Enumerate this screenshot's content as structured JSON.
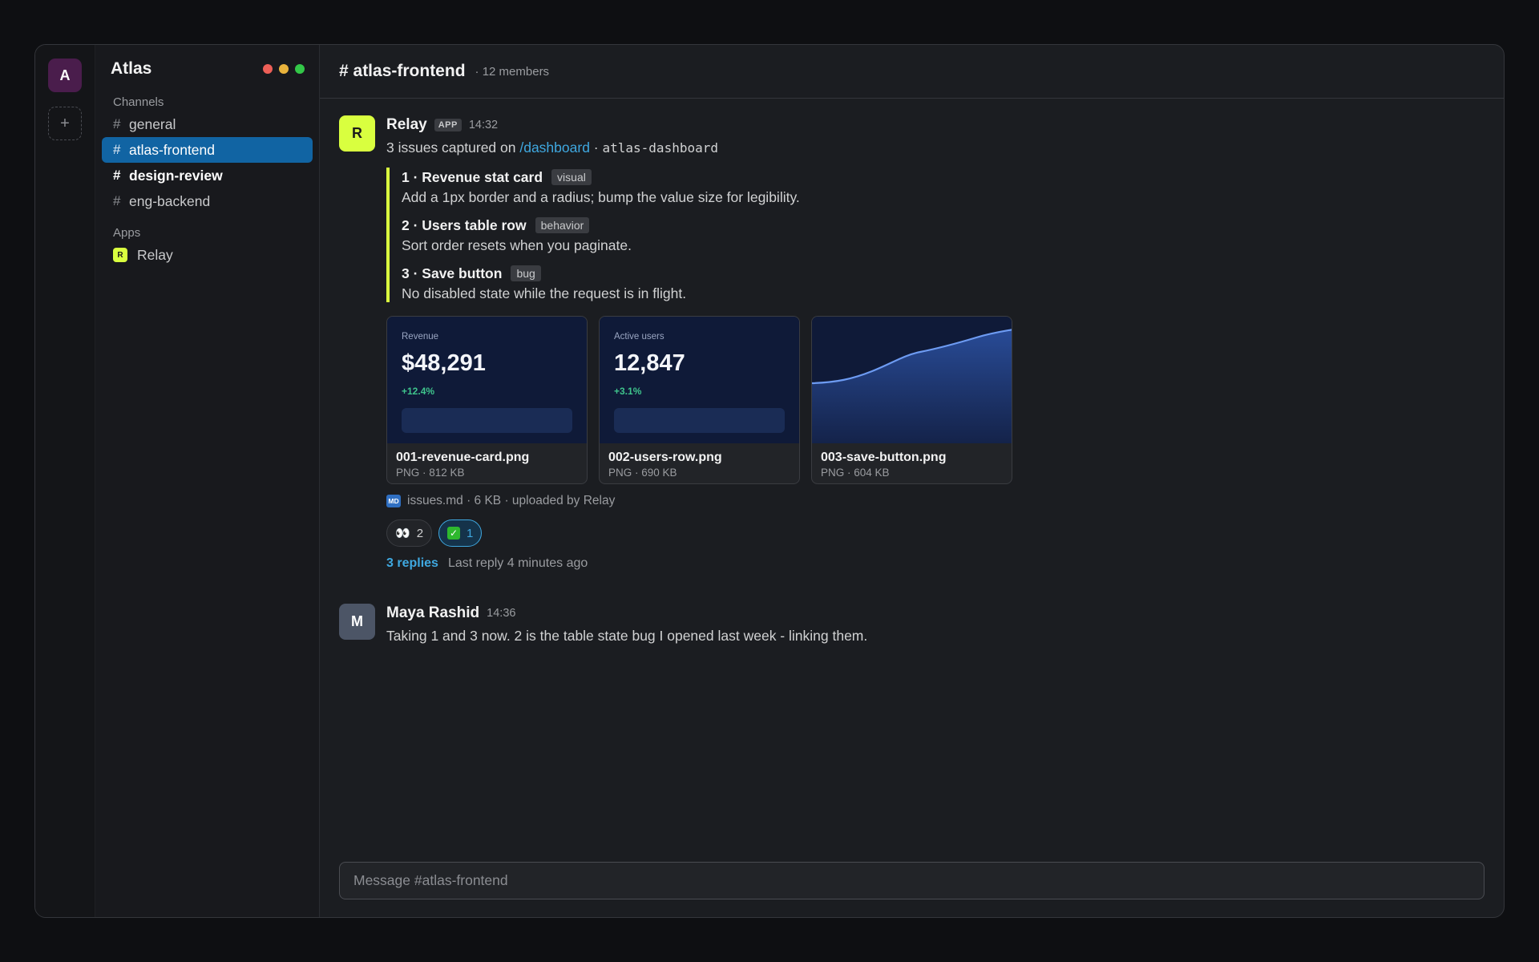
{
  "workspace": {
    "initial": "A",
    "add_symbol": "+",
    "name": "Atlas"
  },
  "sidebar": {
    "channels_label": "Channels",
    "channels": [
      {
        "name": "general",
        "state": "normal"
      },
      {
        "name": "atlas-frontend",
        "state": "active"
      },
      {
        "name": "design-review",
        "state": "unread"
      },
      {
        "name": "eng-backend",
        "state": "normal"
      }
    ],
    "apps_label": "Apps",
    "apps": [
      {
        "name": "Relay",
        "badge": "R"
      }
    ],
    "hash": "#"
  },
  "header": {
    "channel": "# atlas-frontend",
    "members": "· 12 members"
  },
  "messages": [
    {
      "avatar": "R",
      "author": "Relay",
      "badge": "APP",
      "time": "14:32",
      "text_prefix": "3 issues captured on ",
      "link": "/dashboard",
      "text_sep": " · ",
      "code": "atlas-dashboard",
      "issues": [
        {
          "title": "1 · Revenue stat card",
          "tag": "visual",
          "desc": "Add a 1px border and a radius; bump the value size for legibility."
        },
        {
          "title": "2 · Users table row",
          "tag": "behavior",
          "desc": "Sort order resets when you paginate."
        },
        {
          "title": "3 · Save button",
          "tag": "bug",
          "desc": "No disabled state while the request is in flight."
        }
      ],
      "attachments": [
        {
          "name": "001-revenue-card.png",
          "size": "PNG · 812 KB",
          "thumb_label": "Revenue",
          "thumb_value": "$48,291",
          "thumb_delta": "+12.4%"
        },
        {
          "name": "002-users-row.png",
          "size": "PNG · 690 KB",
          "thumb_label": "Active users",
          "thumb_value": "12,847",
          "thumb_delta": "+3.1%"
        },
        {
          "name": "003-save-button.png",
          "size": "PNG · 604 KB"
        }
      ],
      "file": {
        "icon": "MD",
        "text": "issues.md · 6 KB · uploaded by Relay"
      },
      "reactions": [
        {
          "emoji": "👀",
          "count": "2",
          "mine": false
        },
        {
          "emoji": "✓",
          "count": "1",
          "mine": true
        }
      ],
      "replies": {
        "count": "3 replies",
        "last": "Last reply 4 minutes ago"
      }
    },
    {
      "avatar": "M",
      "author": "Maya Rashid",
      "time": "14:36",
      "text": "Taking 1 and 3 now. 2 is the table state bug I opened last week - linking them."
    }
  ],
  "composer": {
    "placeholder": "Message #atlas-frontend"
  },
  "colors": {
    "accent": "#1164a3",
    "relay": "#d9ff3f",
    "link": "#3fa8e0",
    "workspace": "#4a1d4c"
  }
}
